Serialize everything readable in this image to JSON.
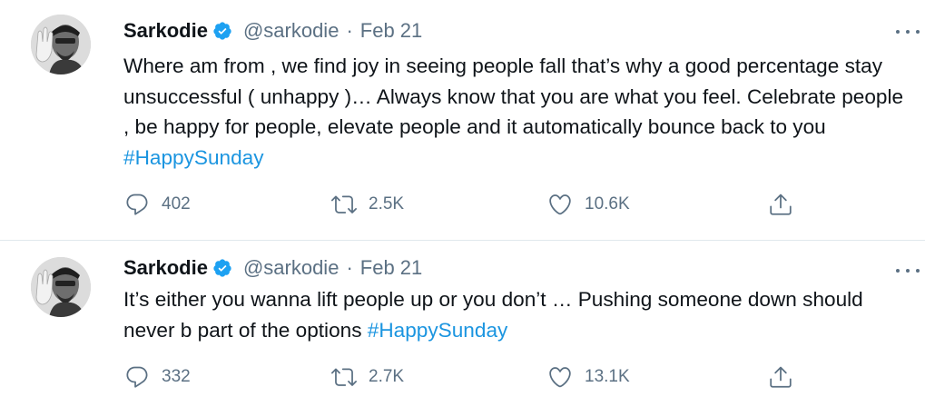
{
  "tweets": [
    {
      "author": {
        "name": "Sarkodie",
        "handle": "@sarkodie",
        "date": "Feb 21"
      },
      "text": "Where am from , we find joy in seeing people fall that’s why a good percentage stay unsuccessful ( unhappy )… Always know that you are what you feel. Celebrate people , be happy for people, elevate people and it automatically bounce back to you ",
      "hashtag": "#HappySunday",
      "stats": {
        "replies": "402",
        "retweets": "2.5K",
        "likes": "10.6K"
      }
    },
    {
      "author": {
        "name": "Sarkodie",
        "handle": "@sarkodie",
        "date": "Feb 21"
      },
      "text": "It’s either you wanna lift people up or you don’t … Pushing someone down should never b part of the options ",
      "hashtag": "#HappySunday",
      "stats": {
        "replies": "332",
        "retweets": "2.7K",
        "likes": "13.1K"
      }
    }
  ],
  "ui": {
    "separator": "·",
    "icons": {
      "verified": "verified-badge-icon",
      "more": "more-options-icon",
      "reply": "reply-icon",
      "retweet": "retweet-icon",
      "like": "like-icon",
      "share": "share-icon"
    }
  },
  "colors": {
    "text": "#0f1419",
    "secondary": "#5b7083",
    "link": "#1b95e0",
    "verified": "#1da1f2",
    "divider": "#e1e8ed"
  }
}
